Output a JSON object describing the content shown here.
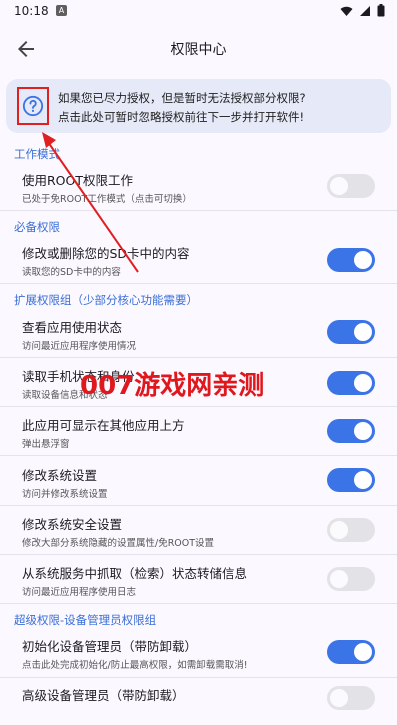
{
  "status_bar": {
    "time": "10:18",
    "notification_badge": "A",
    "icons": [
      "wifi-icon",
      "signal-icon",
      "battery-icon"
    ]
  },
  "app_bar": {
    "title": "权限中心",
    "back_icon": "arrow-back-icon"
  },
  "banner": {
    "icon": "help-circle-icon",
    "line1": "如果您已尽力授权，但是暂时无法授权部分权限?",
    "line2": "点击此处可暂时忽略授权前往下一步并打开软件!"
  },
  "sections": [
    {
      "title": "工作模式",
      "items": [
        {
          "title": "使用ROOT权限工作",
          "subtitle": "已处于免ROOT工作模式（点击可切换）",
          "enabled": false
        }
      ]
    },
    {
      "title": "必备权限",
      "items": [
        {
          "title": "修改或删除您的SD卡中的内容",
          "subtitle": "读取您的SD卡中的内容",
          "enabled": true
        }
      ]
    },
    {
      "title": "扩展权限组（少部分核心功能需要）",
      "items": [
        {
          "title": "查看应用使用状态",
          "subtitle": "访问最近应用程序使用情况",
          "enabled": true
        },
        {
          "title": "读取手机状态和身份",
          "subtitle": "读取设备信息和状态",
          "enabled": true
        },
        {
          "title": "此应用可显示在其他应用上方",
          "subtitle": "弹出悬浮窗",
          "enabled": true
        },
        {
          "title": "修改系统设置",
          "subtitle": "访问并修改系统设置",
          "enabled": true
        },
        {
          "title": "修改系统安全设置",
          "subtitle": "修改大部分系统隐藏的设置属性/免ROOT设置",
          "enabled": false
        },
        {
          "title": "从系统服务中抓取（检索）状态转储信息",
          "subtitle": "访问最近应用程序使用日志",
          "enabled": false
        }
      ]
    },
    {
      "title": "超级权限-设备管理员权限组",
      "items": [
        {
          "title": "初始化设备管理员（带防卸载）",
          "subtitle": "点击此处完成初始化/防止最高权限，如需卸载需取消!",
          "enabled": true
        },
        {
          "title": "高级设备管理员（带防卸载）",
          "subtitle": "",
          "enabled": false
        }
      ]
    }
  ],
  "watermark": "007游戏网亲测",
  "colors": {
    "accent": "#3b74e6",
    "section_title": "#3b6fd6",
    "highlight_box": "#e02020",
    "background": "#fbf8ff"
  }
}
